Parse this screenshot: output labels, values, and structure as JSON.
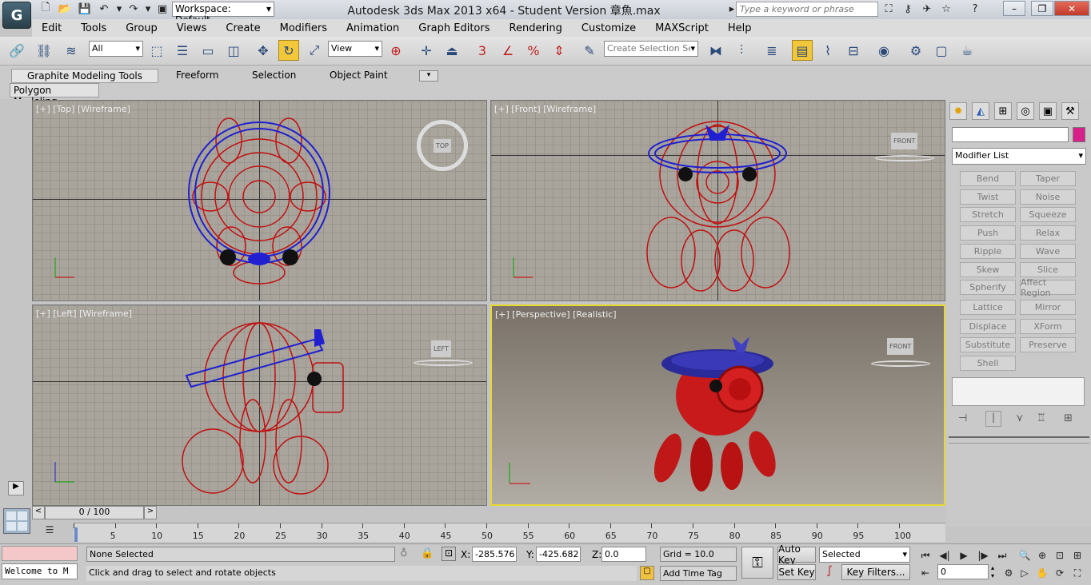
{
  "title_bar": {
    "workspace": "Workspace: Default",
    "title": "Autodesk 3ds Max  2013 x64  - Student Version     章魚.max",
    "search_placeholder": "Type a keyword or phrase"
  },
  "menu": [
    "Edit",
    "Tools",
    "Group",
    "Views",
    "Create",
    "Modifiers",
    "Animation",
    "Graph Editors",
    "Rendering",
    "Customize",
    "MAXScript",
    "Help"
  ],
  "toolbar": {
    "selection_filter": "All",
    "reference_coord": "View",
    "named_selection_placeholder": "Create Selection Set",
    "snap_angle": "3",
    "snap_percent": "%"
  },
  "ribbon": {
    "tabs": [
      "Graphite Modeling Tools",
      "Freeform",
      "Selection",
      "Object Paint"
    ],
    "panel": "Polygon Modeling"
  },
  "viewports": [
    {
      "label": "[+] [Top] [Wireframe]",
      "cube": "TOP"
    },
    {
      "label": "[+] [Front] [Wireframe]",
      "cube": "FRONT"
    },
    {
      "label": "[+] [Left] [Wireframe]",
      "cube": "LEFT"
    },
    {
      "label": "[+] [Perspective] [Realistic]",
      "cube": "FRONT"
    }
  ],
  "command_panel": {
    "modifier_list": "Modifier List",
    "modifiers": [
      "Bend",
      "Taper",
      "Twist",
      "Noise",
      "Stretch",
      "Squeeze",
      "Push",
      "Relax",
      "Ripple",
      "Wave",
      "Skew",
      "Slice",
      "Spherify",
      "Affect Region",
      "Lattice",
      "Mirror",
      "Displace",
      "XForm",
      "Substitute",
      "Preserve",
      "Shell"
    ]
  },
  "timeline": {
    "frame": "0 / 100",
    "ticks": [
      "0",
      "5",
      "10",
      "15",
      "20",
      "25",
      "30",
      "35",
      "40",
      "45",
      "50",
      "55",
      "60",
      "65",
      "70",
      "75",
      "80",
      "85",
      "90",
      "95",
      "100"
    ]
  },
  "status": {
    "maxscript": "Welcome to M",
    "selection": "None Selected",
    "prompt": "Click and drag to select and rotate objects",
    "x_label": "X:",
    "x": "-285.576",
    "y_label": "Y:",
    "y": "-425.682",
    "z_label": "Z:",
    "z": "0.0",
    "grid": "Grid = 10.0",
    "add_time_tag": "Add Time Tag",
    "auto_key": "Auto Key",
    "set_key": "Set Key",
    "key_mode": "Selected",
    "key_filters": "Key Filters...",
    "current_frame": "0"
  },
  "colors": {
    "accent": "#e8d830",
    "wire_red": "#c01010",
    "wire_blue": "#2020d0"
  }
}
